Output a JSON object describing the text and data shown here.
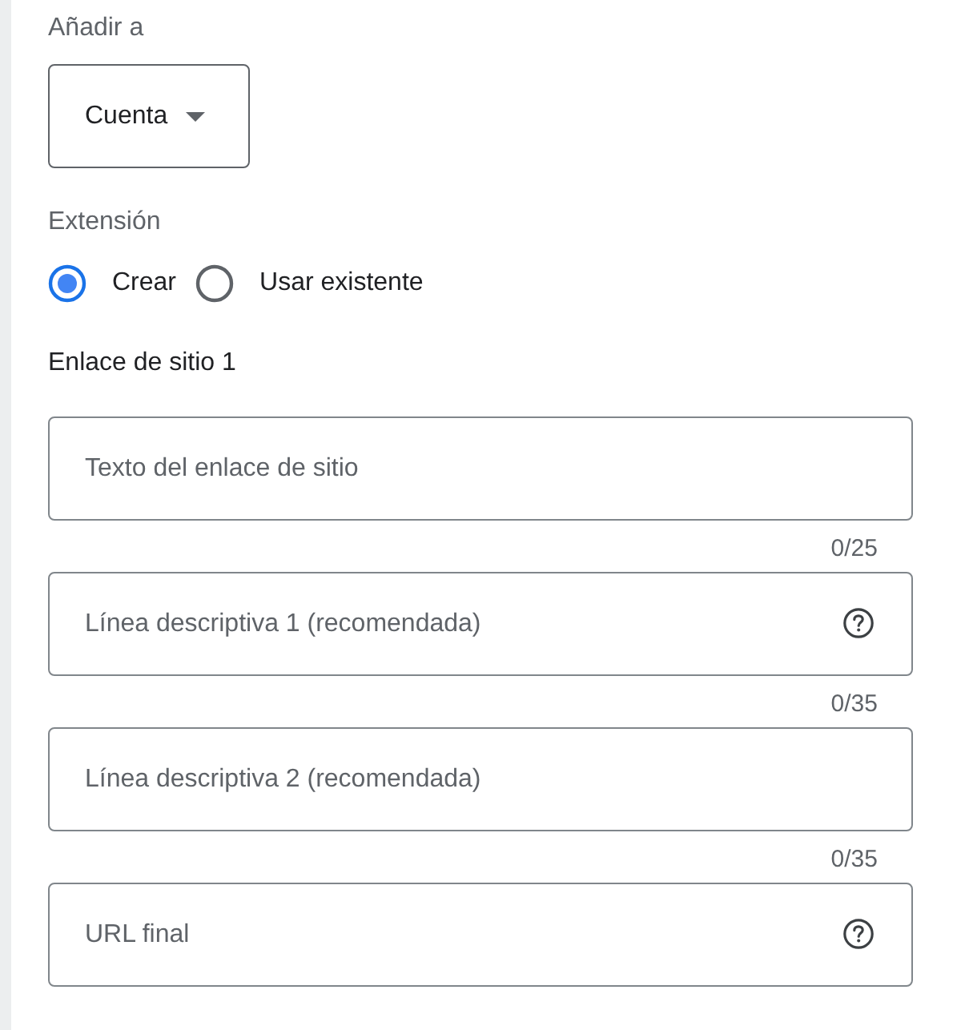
{
  "add_to": {
    "label": "Añadir a",
    "dropdown": {
      "value": "Cuenta"
    }
  },
  "extension": {
    "label": "Extensión",
    "options": [
      {
        "label": "Crear",
        "selected": true
      },
      {
        "label": "Usar existente",
        "selected": false
      }
    ]
  },
  "sitelink": {
    "title": "Enlace de sitio 1",
    "fields": [
      {
        "placeholder": "Texto del enlace de sitio",
        "help": false,
        "counter": "0/25"
      },
      {
        "placeholder": "Línea descriptiva 1 (recomendada)",
        "help": true,
        "counter": "0/35"
      },
      {
        "placeholder": "Línea descriptiva 2 (recomendada)",
        "help": false,
        "counter": "0/35"
      },
      {
        "placeholder": "URL final",
        "help": true
      }
    ]
  }
}
